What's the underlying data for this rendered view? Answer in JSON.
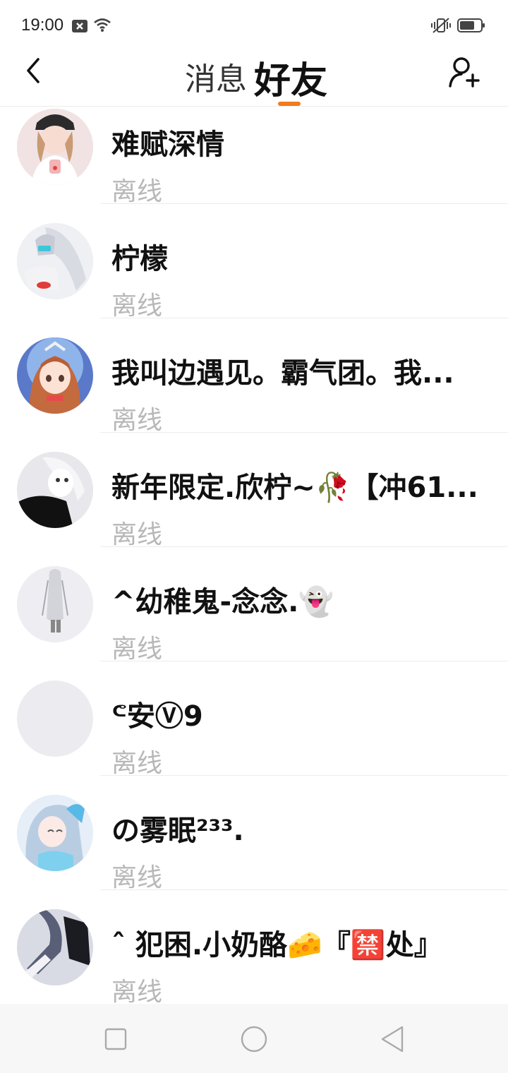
{
  "status_bar": {
    "time": "19:00",
    "icons": [
      "notification-x-icon",
      "wifi-icon",
      "vibrate-icon",
      "battery-icon"
    ]
  },
  "nav": {
    "back_icon": "chevron-left-icon",
    "tabs": [
      {
        "label": "消息",
        "active": false
      },
      {
        "label": "好友",
        "active": true
      }
    ],
    "add_friend_icon": "add-user-icon",
    "accent_color": "#f07c1e"
  },
  "friends": [
    {
      "name": "难赋深情",
      "status": "离线"
    },
    {
      "name": "柠檬",
      "status": "离线"
    },
    {
      "name": "我叫边遇见。霸气团。我...",
      "status": "离线"
    },
    {
      "name": "新年限定.欣柠~🥀【冲61...",
      "status": "离线"
    },
    {
      "name": "^幼稚鬼-念念.👻",
      "status": "离线"
    },
    {
      "name": "ᕪ安Ⓥ9",
      "status": "离线"
    },
    {
      "name": "の雾眠²³³.",
      "status": "离线"
    },
    {
      "name": "ˆ 犯困.小奶酪🧀『🈲处』",
      "status": "离线"
    }
  ],
  "system_nav": {
    "icons": [
      "square-recent-icon",
      "circle-home-icon",
      "triangle-back-icon"
    ]
  }
}
